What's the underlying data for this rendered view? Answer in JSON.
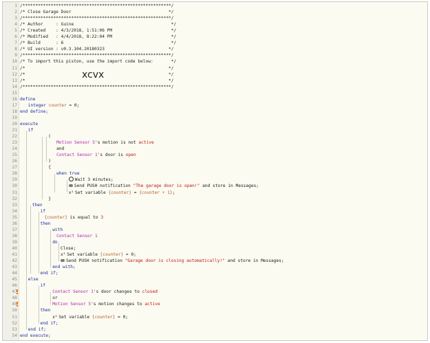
{
  "editor": {
    "lines": [
      {
        "n": "1",
        "indent": 0,
        "parts": [
          {
            "t": "c",
            "s": "/**********************************************************/"
          }
        ]
      },
      {
        "n": "2",
        "indent": 0,
        "parts": [
          {
            "t": "c",
            "s": "/* Close Garage Door                                      */"
          }
        ]
      },
      {
        "n": "3",
        "indent": 0,
        "parts": [
          {
            "t": "c",
            "s": "/**********************************************************/"
          }
        ]
      },
      {
        "n": "4",
        "indent": 0,
        "parts": [
          {
            "t": "c",
            "s": "/* Author     : Guine                                      */"
          }
        ]
      },
      {
        "n": "5",
        "indent": 0,
        "parts": [
          {
            "t": "c",
            "s": "/* Created    : 4/3/2018, 1:51:06 PM                       */"
          }
        ]
      },
      {
        "n": "6",
        "indent": 0,
        "parts": [
          {
            "t": "c",
            "s": "/* Modified   : 4/4/2018, 8:22:04 PM                       */"
          }
        ]
      },
      {
        "n": "7",
        "indent": 0,
        "parts": [
          {
            "t": "c",
            "s": "/* Build      : 6                                          */"
          }
        ]
      },
      {
        "n": "8",
        "indent": 0,
        "parts": [
          {
            "t": "c",
            "s": "/* UI version : v0.3.104.20180323                         */"
          }
        ]
      },
      {
        "n": "9",
        "indent": 0,
        "parts": [
          {
            "t": "c",
            "s": "/**********************************************************/"
          }
        ]
      },
      {
        "n": "10",
        "indent": 0,
        "parts": [
          {
            "t": "c",
            "s": "/* To import this piston, use the import code below:       */"
          }
        ]
      },
      {
        "n": "11",
        "indent": 0,
        "parts": [
          {
            "t": "c",
            "s": "/*                                                        */"
          }
        ]
      },
      {
        "n": "12",
        "indent": 0,
        "parts": [
          {
            "t": "c",
            "s": "/*                                                        */"
          }
        ],
        "big": "xcvx"
      },
      {
        "n": "13",
        "indent": 0,
        "parts": [
          {
            "t": "c",
            "s": "/*                                                        */"
          }
        ]
      },
      {
        "n": "14",
        "indent": 0,
        "parts": [
          {
            "t": "c",
            "s": "/**********************************************************/"
          }
        ]
      },
      {
        "n": "15",
        "indent": 0,
        "parts": []
      },
      {
        "n": "16",
        "indent": 0,
        "parts": [
          {
            "t": "k",
            "s": "define"
          }
        ]
      },
      {
        "n": "17",
        "indent": 2,
        "parts": [
          {
            "t": "k",
            "s": "integer "
          },
          {
            "t": "v",
            "s": "counter"
          },
          {
            "t": "x",
            "s": " = 0;"
          }
        ]
      },
      {
        "n": "18",
        "indent": 0,
        "parts": [
          {
            "t": "k",
            "s": "end define;"
          }
        ]
      },
      {
        "n": "19",
        "indent": 0,
        "parts": []
      },
      {
        "n": "20",
        "indent": 0,
        "parts": [
          {
            "t": "k",
            "s": "execute"
          }
        ]
      },
      {
        "n": "21",
        "indent": 2,
        "parts": [
          {
            "t": "k",
            "s": "if"
          }
        ]
      },
      {
        "n": "22",
        "indent": 7,
        "parts": [
          {
            "t": "x",
            "s": "("
          }
        ]
      },
      {
        "n": "23",
        "indent": 9,
        "parts": [
          {
            "t": "d",
            "s": "Motion Sensor 5"
          },
          {
            "t": "x",
            "s": "'s "
          },
          {
            "t": "x",
            "s": "motion"
          },
          {
            "t": "x",
            "s": " is not "
          },
          {
            "t": "r",
            "s": "active"
          }
        ]
      },
      {
        "n": "24",
        "indent": 9,
        "parts": [
          {
            "t": "x",
            "s": "and"
          }
        ]
      },
      {
        "n": "25",
        "indent": 9,
        "parts": [
          {
            "t": "d",
            "s": "Contact Sensor 1"
          },
          {
            "t": "x",
            "s": "'s "
          },
          {
            "t": "x",
            "s": "door"
          },
          {
            "t": "x",
            "s": " is "
          },
          {
            "t": "r",
            "s": "open"
          }
        ]
      },
      {
        "n": "26",
        "indent": 7,
        "parts": [
          {
            "t": "x",
            "s": ")"
          }
        ]
      },
      {
        "n": "27",
        "indent": 7,
        "parts": [
          {
            "t": "x",
            "s": "{"
          }
        ]
      },
      {
        "n": "28",
        "indent": 9,
        "parts": [
          {
            "t": "k",
            "s": "when true"
          }
        ]
      },
      {
        "n": "29",
        "indent": 12,
        "parts": [
          {
            "t": "i",
            "s": "clock"
          },
          {
            "t": "x",
            "s": "Wait 3 minutes;"
          }
        ]
      },
      {
        "n": "30",
        "indent": 12,
        "parts": [
          {
            "t": "i",
            "s": "chat"
          },
          {
            "t": "x",
            "s": "Send PUSH notification "
          },
          {
            "t": "r",
            "s": "\"The garage door is open!\""
          },
          {
            "t": "x",
            "s": " and store in Messages;"
          }
        ]
      },
      {
        "n": "31",
        "indent": 12,
        "parts": [
          {
            "t": "i",
            "s": "x2"
          },
          {
            "t": "x",
            "s": "Set variable "
          },
          {
            "t": "v",
            "s": "{counter}"
          },
          {
            "t": "x",
            "s": " = "
          },
          {
            "t": "v",
            "s": "{counter + 1}"
          },
          {
            "t": "x",
            "s": ";"
          }
        ]
      },
      {
        "n": "32",
        "indent": 7,
        "parts": [
          {
            "t": "x",
            "s": "}"
          }
        ]
      },
      {
        "n": "33",
        "indent": 3,
        "parts": [
          {
            "t": "k",
            "s": "then"
          }
        ]
      },
      {
        "n": "34",
        "indent": 5,
        "parts": [
          {
            "t": "k",
            "s": "if"
          }
        ]
      },
      {
        "n": "35",
        "indent": 6,
        "parts": [
          {
            "t": "v",
            "s": "{counter}"
          },
          {
            "t": "x",
            "s": " is equal to "
          },
          {
            "t": "r",
            "s": "3"
          }
        ]
      },
      {
        "n": "36",
        "indent": 5,
        "parts": [
          {
            "t": "k",
            "s": "then"
          }
        ]
      },
      {
        "n": "37",
        "indent": 8,
        "parts": [
          {
            "t": "k",
            "s": "with"
          }
        ]
      },
      {
        "n": "38",
        "indent": 9,
        "parts": [
          {
            "t": "d",
            "s": "Contact Sensor 1"
          }
        ]
      },
      {
        "n": "39",
        "indent": 8,
        "parts": [
          {
            "t": "k",
            "s": "do"
          }
        ]
      },
      {
        "n": "40",
        "indent": 10,
        "parts": [
          {
            "t": "x",
            "s": "Close;"
          }
        ]
      },
      {
        "n": "41",
        "indent": 10,
        "parts": [
          {
            "t": "i",
            "s": "x2"
          },
          {
            "t": "x",
            "s": "Set variable "
          },
          {
            "t": "v",
            "s": "{counter}"
          },
          {
            "t": "x",
            "s": " = 0;"
          }
        ]
      },
      {
        "n": "42",
        "indent": 10,
        "parts": [
          {
            "t": "i",
            "s": "chat"
          },
          {
            "t": "x",
            "s": "Send PUSH notification "
          },
          {
            "t": "r",
            "s": "\"Garage door is closing automatically!\""
          },
          {
            "t": "x",
            "s": " and store in Messages;"
          }
        ]
      },
      {
        "n": "43",
        "indent": 8,
        "parts": [
          {
            "t": "k",
            "s": "end with;"
          }
        ]
      },
      {
        "n": "44",
        "indent": 5,
        "parts": [
          {
            "t": "k",
            "s": "end if;"
          }
        ]
      },
      {
        "n": "45",
        "indent": 2,
        "parts": [
          {
            "t": "k",
            "s": "else"
          }
        ]
      },
      {
        "n": "46",
        "indent": 5,
        "parts": [
          {
            "t": "k",
            "s": "if"
          }
        ]
      },
      {
        "n": "47",
        "indent": 8,
        "parts": [
          {
            "t": "d",
            "s": "Contact Sensor 1"
          },
          {
            "t": "x",
            "s": "'s "
          },
          {
            "t": "x",
            "s": "door"
          },
          {
            "t": "x",
            "s": " changes to "
          },
          {
            "t": "r",
            "s": "closed"
          }
        ],
        "mark": true
      },
      {
        "n": "48",
        "indent": 8,
        "parts": [
          {
            "t": "x",
            "s": "or"
          }
        ]
      },
      {
        "n": "49",
        "indent": 8,
        "parts": [
          {
            "t": "d",
            "s": "Motion Sensor 5"
          },
          {
            "t": "x",
            "s": "'s "
          },
          {
            "t": "x",
            "s": "motion"
          },
          {
            "t": "x",
            "s": " changes to "
          },
          {
            "t": "r",
            "s": "active"
          }
        ],
        "mark": true
      },
      {
        "n": "50",
        "indent": 5,
        "parts": [
          {
            "t": "k",
            "s": "then"
          }
        ]
      },
      {
        "n": "51",
        "indent": 8,
        "parts": [
          {
            "t": "i",
            "s": "x2"
          },
          {
            "t": "x",
            "s": "Set variable "
          },
          {
            "t": "v",
            "s": "{counter}"
          },
          {
            "t": "x",
            "s": " = 0;"
          }
        ]
      },
      {
        "n": "52",
        "indent": 5,
        "parts": [
          {
            "t": "k",
            "s": "end if;"
          }
        ]
      },
      {
        "n": "53",
        "indent": 2,
        "parts": [
          {
            "t": "k",
            "s": "end if;"
          }
        ]
      },
      {
        "n": "54",
        "indent": 0,
        "parts": [
          {
            "t": "k",
            "s": "end execute;"
          }
        ]
      }
    ]
  },
  "colors": {
    "keyword": "#1a2aa8",
    "device": "#b022b0",
    "value": "#c01515",
    "variable": "#b65a2a",
    "marker": "#e0731c"
  }
}
